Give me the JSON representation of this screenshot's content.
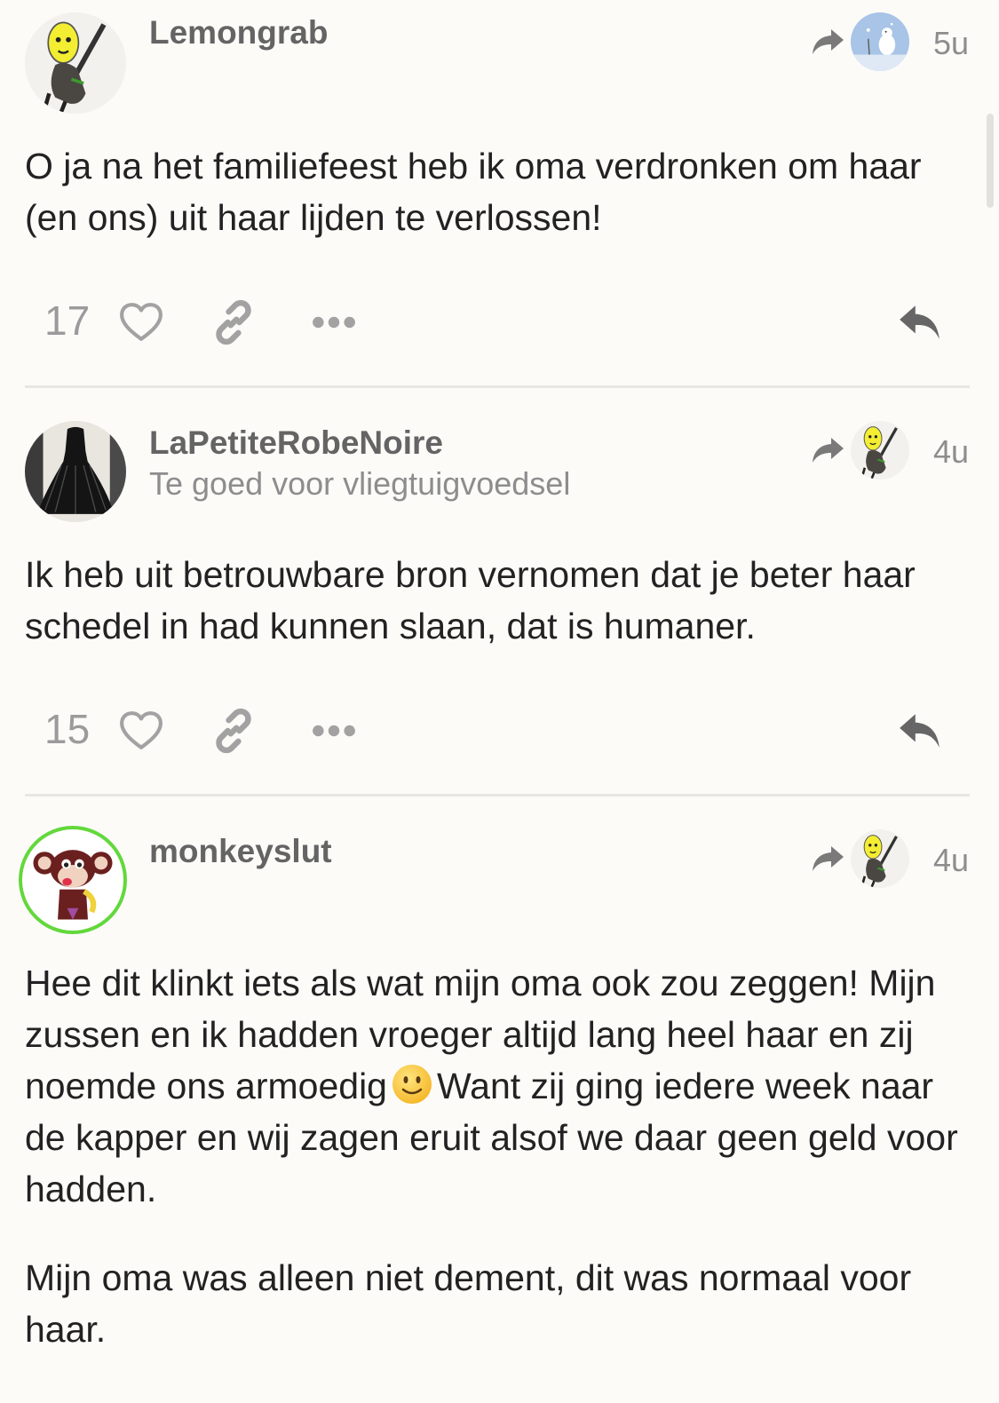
{
  "posts": [
    {
      "username": "Lemongrab",
      "user_title": "",
      "time": "5u",
      "avatar_icon": "lemongrab-avatar",
      "reply_to_avatar_icon": "snowy-avatar",
      "body": [
        "O ja na het familiefeest heb ik oma verdronken om haar (en ons) uit haar lijden te verlossen!"
      ],
      "likes": "17"
    },
    {
      "username": "LaPetiteRobeNoire",
      "user_title": "Te goed voor vliegtuigvoedsel",
      "time": "4u",
      "avatar_icon": "black-dress-avatar",
      "reply_to_avatar_icon": "lemongrab-avatar",
      "body": [
        "Ik heb uit betrouwbare bron vernomen dat je beter haar schedel in had kunnen slaan, dat is humaner."
      ],
      "likes": "15"
    },
    {
      "username": "monkeyslut",
      "user_title": "",
      "time": "4u",
      "avatar_icon": "monkey-avatar",
      "reply_to_avatar_icon": "lemongrab-avatar",
      "body_p1_a": "Hee dit klinkt iets als wat mijn oma ook zou zeggen! Mijn zussen en ik hadden vroeger altijd lang heel haar en zij noemde ons armoedig",
      "body_p1_emoji": "slightly-smiling-face",
      "body_p1_b": "Want zij ging iedere week naar de kapper en wij zagen eruit alsof we daar geen geld voor hadden.",
      "body_p2": "Mijn oma was alleen niet dement, dit was normaal voor haar."
    }
  ],
  "colors": {
    "background": "#fcfbf8",
    "muted": "#8d8d8d",
    "online_ring": "#63d83c"
  }
}
